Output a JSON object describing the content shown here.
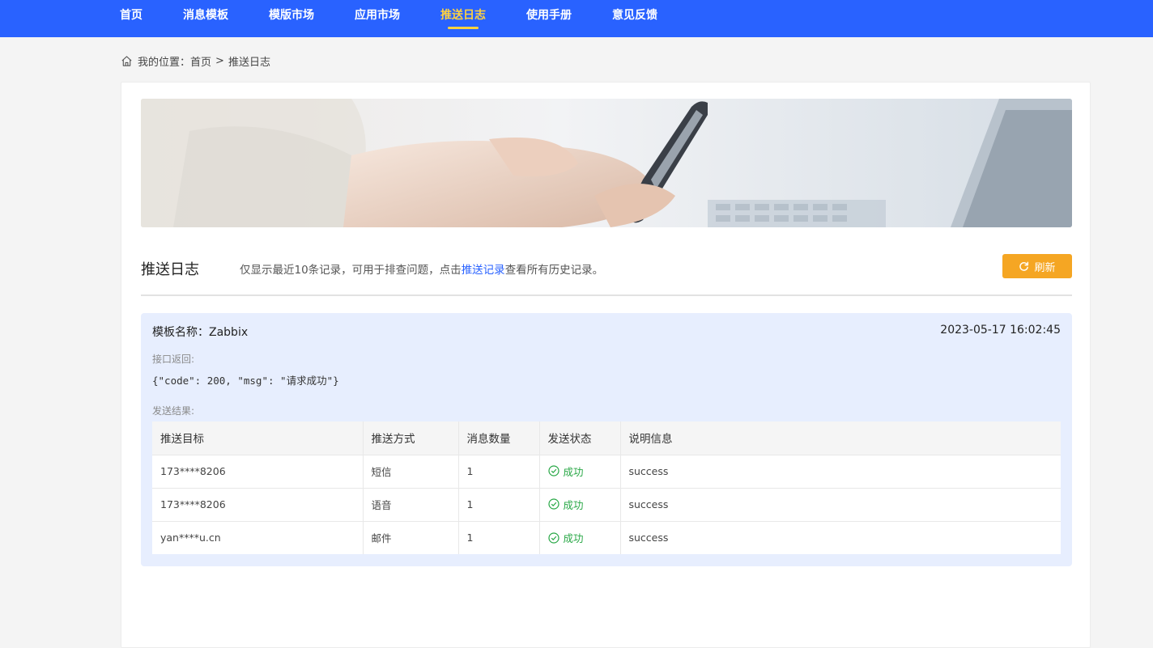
{
  "nav": {
    "items": [
      {
        "label": "首页"
      },
      {
        "label": "消息模板"
      },
      {
        "label": "模版市场"
      },
      {
        "label": "应用市场"
      },
      {
        "label": "推送日志"
      },
      {
        "label": "使用手册"
      },
      {
        "label": "意见反馈"
      }
    ],
    "active": "推送日志",
    "colors": {
      "bar": "#2962ff",
      "active": "#ffd23f"
    }
  },
  "breadcrumb": {
    "prefix": "我的位置：",
    "home": "首页",
    "separator": ">",
    "current": "推送日志",
    "icon": "home-icon"
  },
  "section": {
    "title": "推送日志",
    "desc_before": "仅显示最近10条记录，可用于排查问题，点击",
    "desc_link": "推送记录",
    "desc_after": "查看所有历史记录。",
    "refresh_label": "刷新",
    "refresh_icon": "refresh-icon",
    "refresh_color": "#f5a623"
  },
  "log": {
    "template_label": "模板名称：",
    "template_name": "Zabbix",
    "time": "2023-05-17 16:02:45",
    "response_label": "接口返回:",
    "response_body": "{\"code\": 200, \"msg\": \"请求成功\"}",
    "result_label": "发送结果:",
    "columns": [
      "推送目标",
      "推送方式",
      "消息数量",
      "发送状态",
      "说明信息"
    ],
    "rows": [
      {
        "target": "173****8206",
        "method": "短信",
        "count": "1",
        "status": "成功",
        "info": "success"
      },
      {
        "target": "173****8206",
        "method": "语音",
        "count": "1",
        "status": "成功",
        "info": "success"
      },
      {
        "target": "yan****u.cn",
        "method": "邮件",
        "count": "1",
        "status": "成功",
        "info": "success"
      }
    ],
    "status_color": "#27a745",
    "status_icon": "check-circle-icon"
  }
}
